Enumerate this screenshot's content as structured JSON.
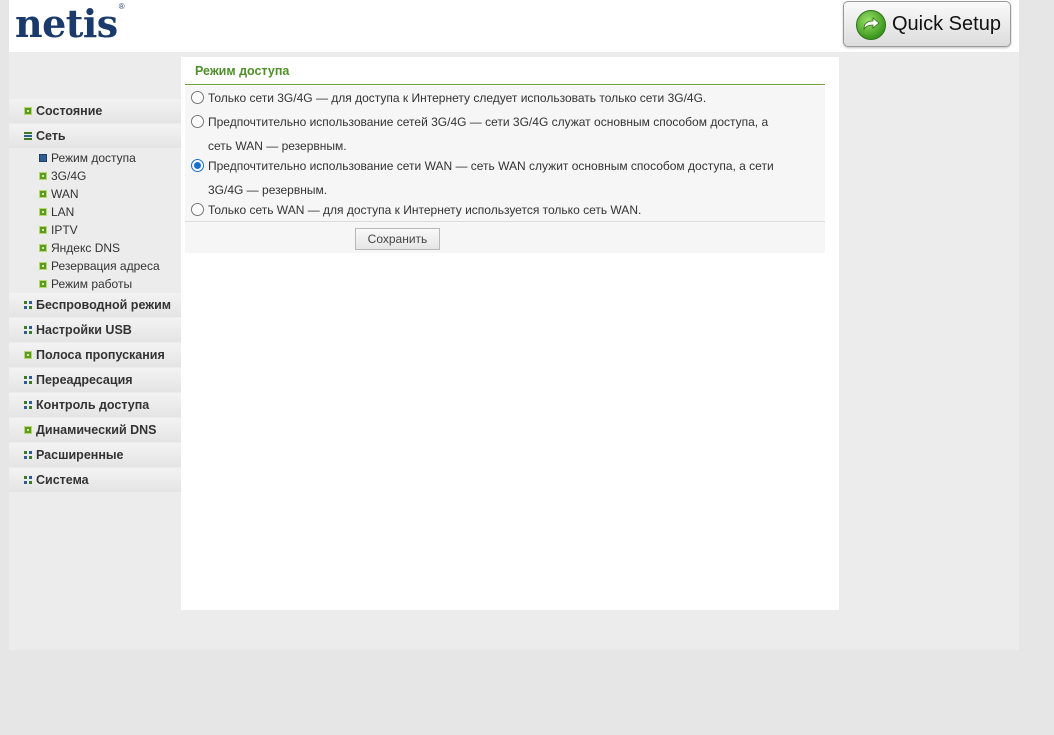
{
  "header": {
    "logo_text": "netis",
    "logo_mark": "®",
    "quick_setup_label": "Quick Setup",
    "quick_setup_icon": "refresh-arrow-icon"
  },
  "sidebar": {
    "items": [
      {
        "label": "Состояние"
      },
      {
        "label": "Сеть",
        "expanded": true,
        "subitems": [
          {
            "label": "Режим доступа",
            "active": true
          },
          {
            "label": "3G/4G"
          },
          {
            "label": "WAN"
          },
          {
            "label": "LAN"
          },
          {
            "label": "IPTV"
          },
          {
            "label": "Яндекс DNS"
          },
          {
            "label": "Резервация адреса"
          },
          {
            "label": "Режим работы"
          }
        ]
      },
      {
        "label": "Беспроводной режим"
      },
      {
        "label": "Настройки USB"
      },
      {
        "label": "Полоса пропускания"
      },
      {
        "label": "Переадресация"
      },
      {
        "label": "Контроль доступа"
      },
      {
        "label": "Динамический DNS"
      },
      {
        "label": "Расширенные"
      },
      {
        "label": "Система"
      }
    ]
  },
  "main": {
    "section_title": "Режим доступа",
    "options": [
      {
        "line1": "Только сети 3G/4G — для доступа к Интернету следует использовать только сети 3G/4G.",
        "line2": "",
        "selected": false
      },
      {
        "line1": "Предпочтительно использование сетей 3G/4G — сети 3G/4G служат основным способом доступа, а",
        "line2": "сеть WAN — резервным.",
        "selected": false
      },
      {
        "line1": "Предпочтительно использование сети WAN — сеть WAN служит основным способом доступа, а сети",
        "line2": "3G/4G — резервным.",
        "selected": true
      },
      {
        "line1": "Только сеть WAN — для доступа к Интернету используется только сеть WAN.",
        "line2": "",
        "selected": false
      }
    ],
    "save_label": "Сохранить"
  },
  "colors": {
    "accent_green": "#4e8f28",
    "logo_blue": "#1a3a6b",
    "radio_blue": "#1a6fcf"
  }
}
